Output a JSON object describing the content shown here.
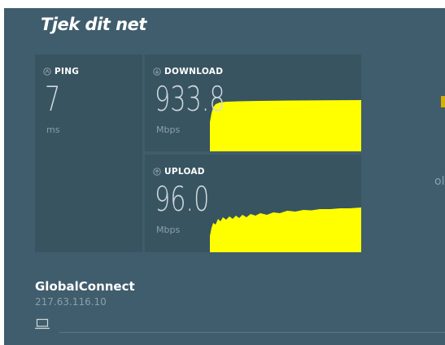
{
  "app": {
    "title": "Tjek dit net"
  },
  "ping": {
    "label": "PING",
    "value": "7",
    "unit": "ms"
  },
  "download": {
    "label": "DOWNLOAD",
    "value": "933.8",
    "unit": "Mbps",
    "graph_color": "#ffff00"
  },
  "upload": {
    "label": "UPLOAD",
    "value": "96.0",
    "unit": "Mbps",
    "graph_color": "#ffff00"
  },
  "side": {
    "partial_text": "ol"
  },
  "server": {
    "name": "GlobalConnect",
    "ip": "217.63.116.10"
  },
  "icons": {
    "ping": "ping-icon",
    "download": "download-icon",
    "upload": "upload-icon",
    "device": "laptop-icon"
  },
  "colors": {
    "background": "#3f5d6c",
    "panel": "#385461",
    "graph": "#ffff00"
  }
}
